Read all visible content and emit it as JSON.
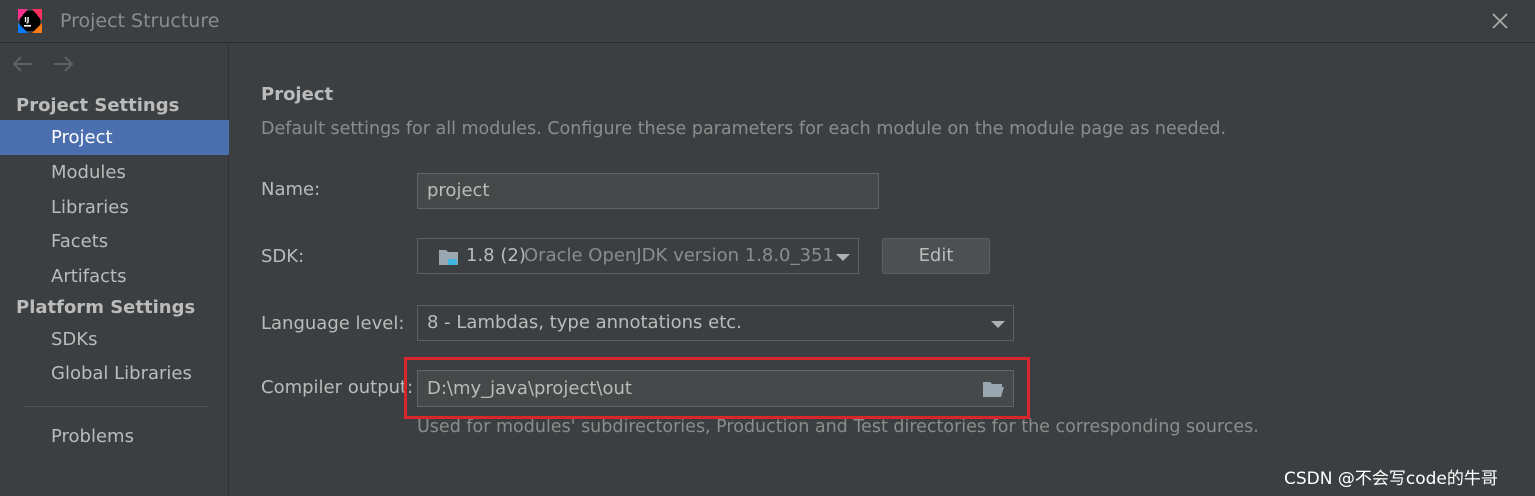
{
  "window": {
    "title": "Project Structure"
  },
  "sidebar": {
    "sections": [
      {
        "title": "Project Settings",
        "items": [
          "Project",
          "Modules",
          "Libraries",
          "Facets",
          "Artifacts"
        ]
      },
      {
        "title": "Platform Settings",
        "items": [
          "SDKs",
          "Global Libraries"
        ]
      }
    ],
    "problems": "Problems",
    "selected": "Project"
  },
  "main": {
    "title": "Project",
    "description": "Default settings for all modules. Configure these parameters for each module on the module page as needed.",
    "name": {
      "label": "Name:",
      "value": "project"
    },
    "sdk": {
      "label": "SDK:",
      "version": "1.8 (2)",
      "detail": "Oracle OpenJDK version 1.8.0_351",
      "edit_label": "Edit"
    },
    "language_level": {
      "label": "Language level:",
      "value": "8 - Lambdas, type annotations etc."
    },
    "compiler_output": {
      "label": "Compiler output:",
      "value": "D:\\my_java\\project\\out",
      "hint": "Used for modules' subdirectories, Production and Test directories for the corresponding sources."
    }
  },
  "watermark": "CSDN @不会写code的牛哥",
  "colors": {
    "background": "#3c3f41",
    "selection": "#4b6eaf",
    "highlight": "#d9262c"
  }
}
